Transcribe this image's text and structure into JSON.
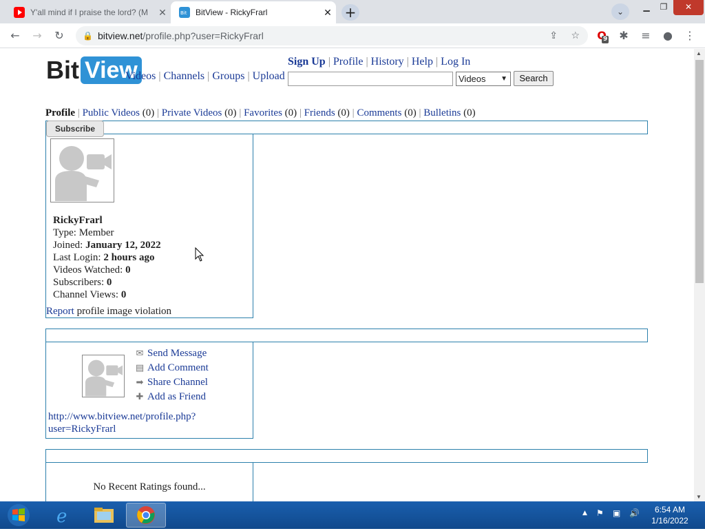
{
  "browser": {
    "tabs": [
      {
        "title": "Y'all mind if I praise the lord? (M",
        "active": false,
        "favicon": "youtube-icon"
      },
      {
        "title": "BitView - RickyFrarl",
        "active": true,
        "favicon": "bitview-icon"
      }
    ],
    "new_tab": "+",
    "url_host": "bitview.net",
    "url_path": "/profile.php?user=RickyFrarl",
    "extension_badge": "9"
  },
  "site": {
    "logo_bit": "Bit",
    "logo_view": "View",
    "main_nav": [
      "Videos",
      "Channels",
      "Groups",
      "Upload"
    ],
    "top_nav": [
      "Sign Up",
      "Profile",
      "History",
      "Help",
      "Log In"
    ],
    "search": {
      "value": "",
      "select": "Videos",
      "button": "Search"
    }
  },
  "profile_nav": [
    {
      "label": "Profile",
      "count": ""
    },
    {
      "label": "Public Videos",
      "count": "(0)"
    },
    {
      "label": "Private Videos",
      "count": "(0)"
    },
    {
      "label": "Favorites",
      "count": "(0)"
    },
    {
      "label": "Friends",
      "count": "(0)"
    },
    {
      "label": "Comments",
      "count": "(0)"
    },
    {
      "label": "Bulletins",
      "count": "(0)"
    }
  ],
  "subscribe_label": "Subscribe",
  "user": {
    "name": "RickyFrarl",
    "type_label": "Type:",
    "type": "Member",
    "joined_label": "Joined:",
    "joined": "January 12, 2022",
    "login_label": "Last Login:",
    "login": "2 hours ago",
    "watched_label": "Videos Watched:",
    "watched": "0",
    "subs_label": "Subscribers:",
    "subs": "0",
    "views_label": "Channel Views:",
    "views": "0"
  },
  "report": {
    "link": "Report",
    "text": " profile image violation"
  },
  "actions": [
    {
      "label": "Send Message",
      "icon": "envelope-icon"
    },
    {
      "label": "Add Comment",
      "icon": "comment-icon"
    },
    {
      "label": "Share Channel",
      "icon": "share-arrow-icon"
    },
    {
      "label": "Add as Friend",
      "icon": "add-friend-icon"
    }
  ],
  "channel_url_line1": "http://www.bitview.net/profile.php?",
  "channel_url_line2": "user=RickyFrarl",
  "no_ratings": "No Recent Ratings found...",
  "clock": {
    "time": "6:54 AM",
    "date": "1/16/2022"
  },
  "colors": {
    "link": "#1a3a96",
    "border": "#2a7fab",
    "taskbar": "#1a5fae"
  }
}
